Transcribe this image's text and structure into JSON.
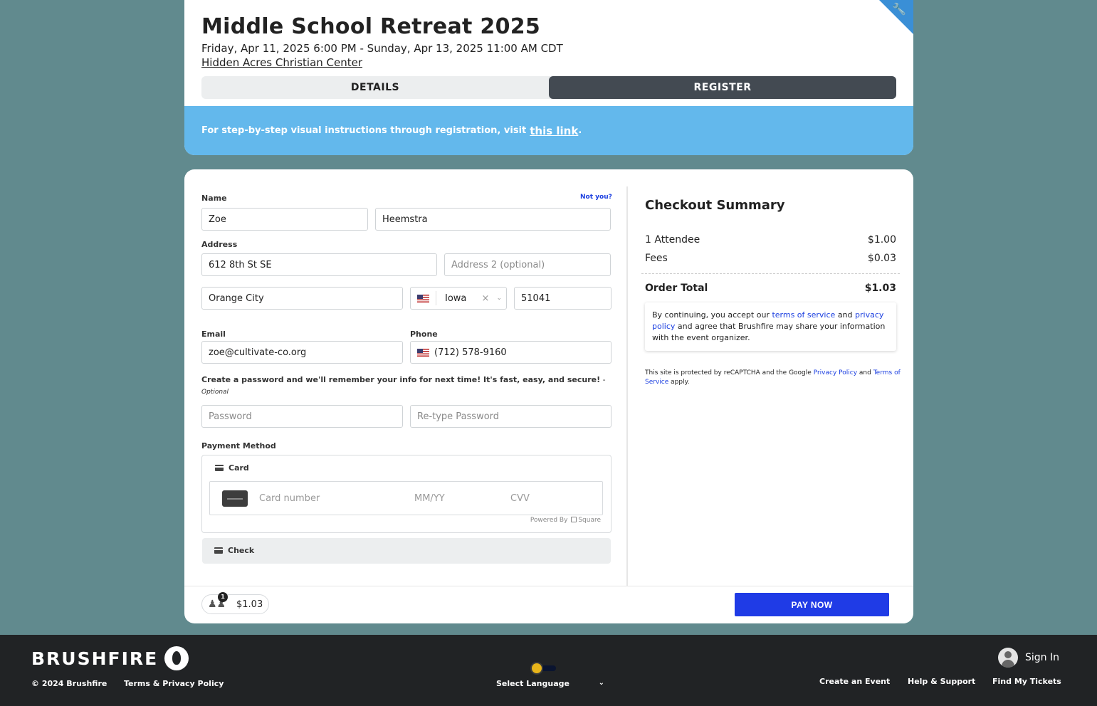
{
  "event": {
    "title": "Middle School Retreat 2025",
    "dates": "Friday, Apr 11, 2025 6:00 PM - Sunday, Apr 13, 2025 11:00 AM CDT",
    "venue": "Hidden Acres Christian Center"
  },
  "tabs": [
    {
      "label": "DETAILS",
      "active": false
    },
    {
      "label": "REGISTER",
      "active": true
    }
  ],
  "banner": {
    "text": "For step-by-step visual instructions through registration, visit",
    "link_text": "this link",
    "suffix": "."
  },
  "form": {
    "name_label": "Name",
    "not_you": "Not you?",
    "first_name": "Zoe",
    "last_name": "Heemstra",
    "address_label": "Address",
    "address1": "612 8th St SE",
    "address2_placeholder": "Address 2 (optional)",
    "city": "Orange City",
    "state": "Iowa",
    "state_clear": "×",
    "zip": "51041",
    "email_label": "Email",
    "email": "zoe@cultivate-co.org",
    "phone_label": "Phone",
    "phone": "(712) 578-9160",
    "password_prompt": "Create a password and we'll remember your info for next time! It's fast, easy, and secure!",
    "password_dash": " -",
    "password_optional": "Optional",
    "password_placeholder": "Password",
    "retype_placeholder": "Re-type Password",
    "payment_label": "Payment Method",
    "card_label": "Card",
    "card_number_placeholder": "Card number",
    "expiry_placeholder": "MM/YY",
    "cvv_placeholder": "CVV",
    "powered_by": "Powered By",
    "square": "Square",
    "check_label": "Check"
  },
  "summary": {
    "title": "Checkout Summary",
    "lines": [
      {
        "label": "1 Attendee",
        "amount": "$1.00"
      },
      {
        "label": "Fees",
        "amount": "$0.03"
      }
    ],
    "total_label": "Order Total",
    "total": "$1.03",
    "terms_pre": "By continuing, you accept our",
    "terms_link": "terms of service",
    "terms_and": "and",
    "privacy_link": "privacy policy",
    "terms_post": "and agree that Brushfire may share your information with the event organizer.",
    "recaptcha_pre": "This site is protected by reCAPTCHA and the Google",
    "recaptcha_privacy": "Privacy Policy",
    "recaptcha_and": "and",
    "recaptcha_terms": "Terms of Service",
    "recaptcha_post": "apply."
  },
  "cart": {
    "count": "1",
    "amount": "$1.03"
  },
  "pay_button": "PAY NOW",
  "footer": {
    "logo": "BRUSHFIRE",
    "copyright": "© 2024 Brushfire",
    "terms": "Terms & Privacy Policy",
    "language": "Select Language",
    "sign_in": "Sign In",
    "links": [
      "Create an Event",
      "Help & Support",
      "Find My Tickets"
    ]
  }
}
